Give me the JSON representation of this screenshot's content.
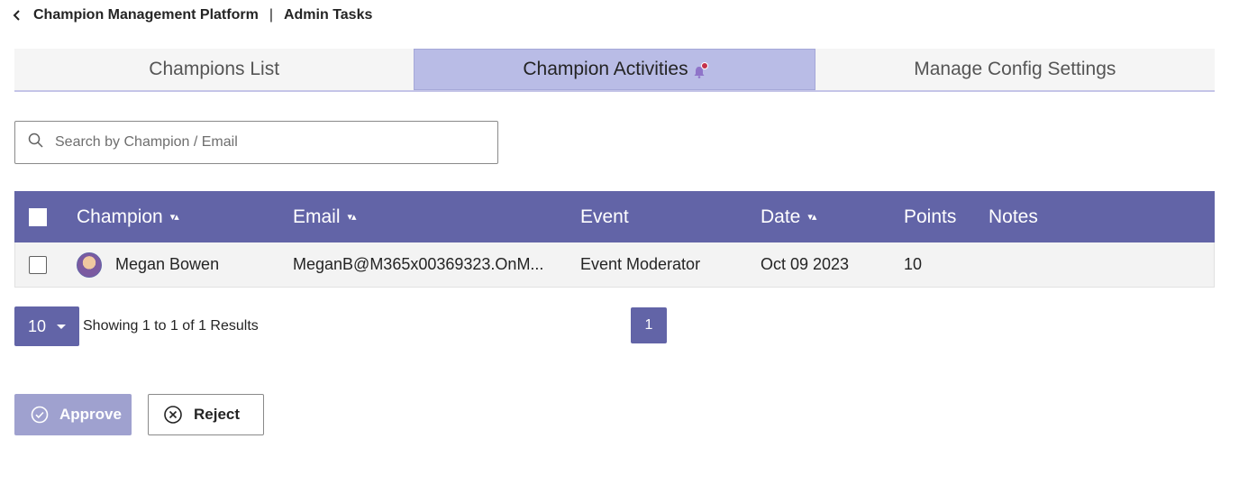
{
  "breadcrumb": {
    "app": "Champion Management Platform",
    "separator": "|",
    "page": "Admin Tasks"
  },
  "tabs": [
    {
      "label": "Champions List",
      "active": false
    },
    {
      "label": "Champion Activities",
      "active": true,
      "icon": "bell-icon"
    },
    {
      "label": "Manage Config Settings",
      "active": false
    }
  ],
  "search": {
    "placeholder": "Search by Champion / Email",
    "value": ""
  },
  "table": {
    "columns": [
      "Champion",
      "Email",
      "Event",
      "Date",
      "Points",
      "Notes"
    ],
    "rows": [
      {
        "champion": "Megan Bowen",
        "email": "MeganB@M365x00369323.OnM...",
        "event": "Event Moderator",
        "date": "Oct 09 2023",
        "points": "10",
        "notes": ""
      }
    ]
  },
  "pagination": {
    "page_size": "10",
    "showing": "Showing 1 to 1 of 1 Results",
    "current_page": "1"
  },
  "actions": {
    "approve": "Approve",
    "reject": "Reject"
  },
  "colors": {
    "accent": "#6264a7",
    "active_tab": "#b9bce6",
    "approve_disabled": "#9fa1cf"
  }
}
